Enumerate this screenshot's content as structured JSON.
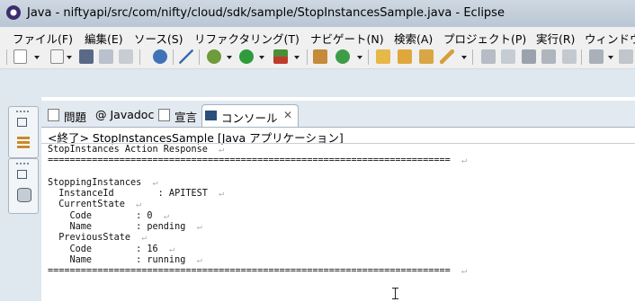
{
  "window": {
    "title": "Java - niftyapi/src/com/nifty/cloud/sdk/sample/StopInstancesSample.java - Eclipse"
  },
  "menu": [
    "ファイル(F)",
    "編集(E)",
    "ソース(S)",
    "リファクタリング(T)",
    "ナビゲート(N)",
    "検索(A)",
    "プロジェクト(P)",
    "実行(R)",
    "ウィンドウ"
  ],
  "tabs": {
    "problems": "問題",
    "javadoc": "@ Javadoc",
    "declaration": "宣言",
    "console": "コンソール",
    "close_glyph": "✕"
  },
  "console": {
    "header": "<終了> StopInstancesSample [Java アプリケーション]",
    "lines": [
      "StopInstances Action Response",
      "=========================================================================",
      "",
      "StoppingInstances",
      "  InstanceId        : APITEST",
      "  CurrentState",
      "    Code        : 0",
      "    Name        : pending",
      "  PreviousState",
      "    Code        : 16",
      "    Name        : running",
      "========================================================================="
    ],
    "eol_marks": [
      true,
      true,
      false,
      true,
      true,
      true,
      true,
      true,
      true,
      true,
      true,
      true
    ],
    "eol_glyph": "↵"
  },
  "icons": {
    "toolbar": [
      "new-icon",
      "open-type-icon",
      "save-icon",
      "save-all-icon",
      "print-icon",
      "settings-icon",
      "skip-breakpoints-icon",
      "debug-icon",
      "run-icon",
      "external-tools-icon",
      "new-java-class-icon",
      "refresh-icon",
      "open-folder-icon",
      "open-project-icon",
      "edit-folder-icon",
      "pen-icon",
      "forward-icon",
      "pin-icon",
      "next-annotation-icon",
      "prev-annotation-icon",
      "columns-icon",
      "back-icon",
      "nav-icon"
    ]
  },
  "colors": {
    "accent": "#2b5a9c",
    "titlebar": "#c5d0dc",
    "chrome": "#dfe7ef"
  }
}
